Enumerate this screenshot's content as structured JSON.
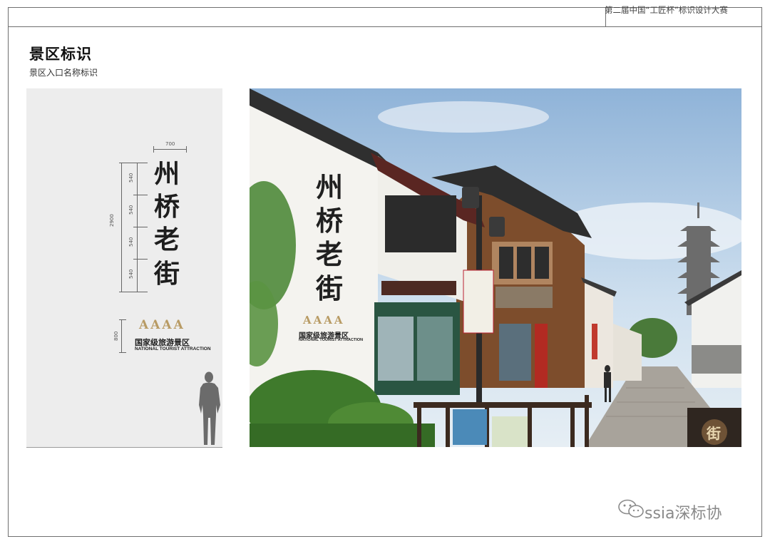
{
  "header": {
    "contest_name": "第二届中国“工匠杯”标识设计大赛"
  },
  "page": {
    "title": "景区标识",
    "subtitle": "景区入口名称标识"
  },
  "elevation": {
    "dim_width": "700",
    "dim_height_total": "2900",
    "dim_segment_1": "540",
    "dim_segment_2": "540",
    "dim_segment_3": "540",
    "dim_segment_4": "540",
    "dim_logo_block": "800",
    "name_chars": [
      "州",
      "桥",
      "老",
      "街"
    ],
    "rating": "AAAA",
    "scenic_level": "国家级旅游景区",
    "scenic_level_en": "NATIONAL TOURIST ATTRACTION"
  },
  "photo": {
    "name_chars": [
      "州",
      "桥",
      "老",
      "街"
    ],
    "rating": "AAAA",
    "scenic_level": "国家级旅游景区",
    "scenic_level_en": "NATIONAL TOURIST ATTRACTION",
    "street_sign_char": "街"
  },
  "watermark": {
    "text": "ssia深标协",
    "icon": "wechat-icon"
  },
  "colors": {
    "frame": "#6f6f6f",
    "gold": "#b89b64",
    "panel": "#ededed"
  }
}
